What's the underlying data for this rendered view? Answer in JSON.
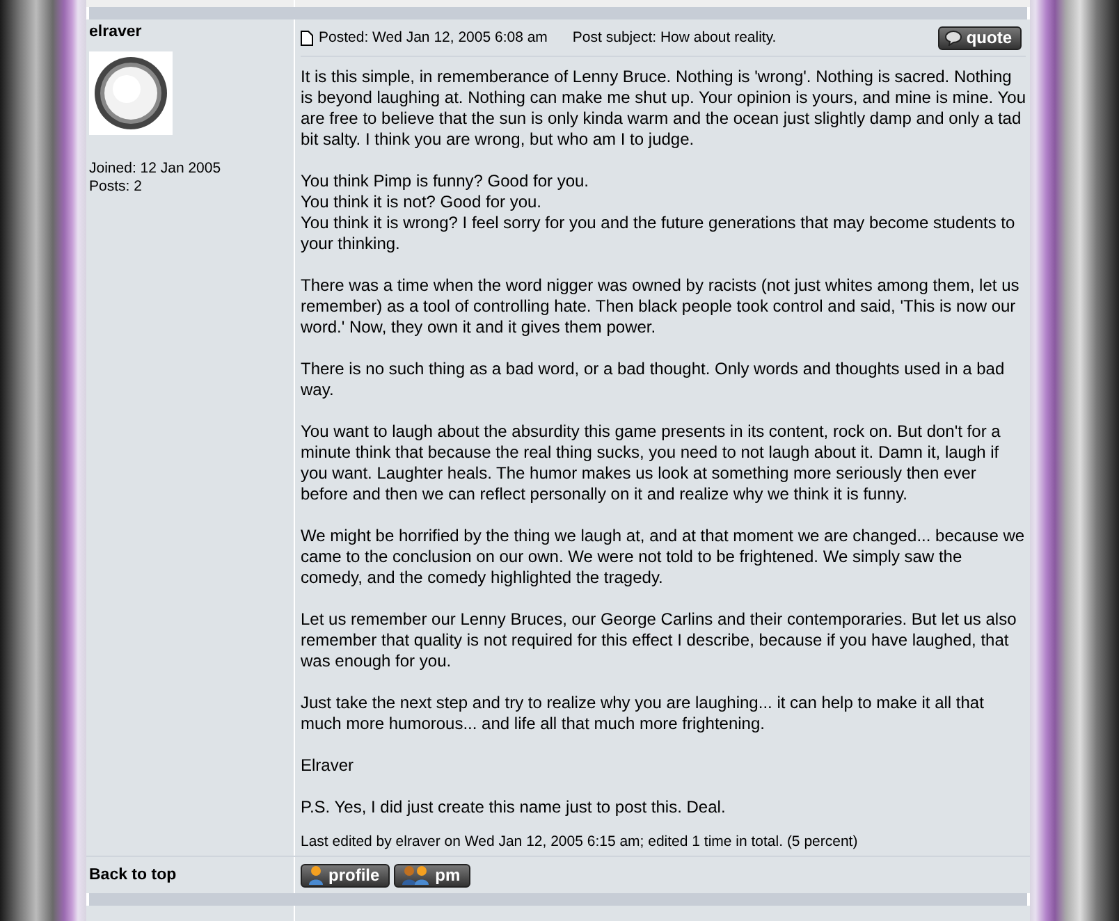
{
  "post": {
    "author": "elraver",
    "joined": "Joined: 12 Jan 2005",
    "posts": "Posts: 2",
    "posted": "Posted: Wed Jan 12, 2005 6:08 am",
    "subject": "Post subject: How about reality.",
    "quote_button": "quote",
    "paragraphs": [
      "It is this simple, in rememberance of Lenny Bruce. Nothing is 'wrong'. Nothing is sacred. Nothing is beyond laughing at. Nothing can make me shut up. Your opinion is yours, and mine is mine. You are free to believe that the sun is only kinda warm and the ocean just slightly damp and only a tad bit salty. I think you are wrong, but who am I to judge.",
      "You think Pimp is funny? Good for you.\nYou think it is not? Good for you.\nYou think it is wrong? I feel sorry for you and the future generations that may become students to your thinking.",
      "There was a time when the word nigger was owned by racists (not just whites among them, let us remember) as a tool of controlling hate. Then black people took control and said, 'This is now our word.' Now, they own it and it gives them power.",
      "There is no such thing as a bad word, or a bad thought. Only words and thoughts used in a bad way.",
      "You want to laugh about the absurdity this game presents in its content, rock on. But don't for a minute think that because the real thing sucks, you need to not laugh about it. Damn it, laugh if you want. Laughter heals. The humor makes us look at something more seriously then ever before and then we can reflect personally on it and realize why we think it is funny.",
      "We might be horrified by the thing we laugh at, and at that moment we are changed... because we came to the conclusion on our own. We were not told to be frightened. We simply saw the comedy, and the comedy highlighted the tragedy.",
      "Let us remember our Lenny Bruces, our George Carlins and their contemporaries. But let us also remember that quality is not required for this effect I describe, because if you have laughed, that was enough for you.",
      "Just take the next step and try to realize why you are laughing... it can help to make it all that much more humorous... and life all that much more frightening.",
      "Elraver",
      "P.S. Yes, I did just create this name just to post this. Deal."
    ],
    "edit_note": "Last edited by elraver on Wed Jan 12, 2005 6:15 am; edited 1 time in total. (5 percent)",
    "back_to_top": "Back to top",
    "buttons": [
      {
        "label": "profile",
        "kind": "profile"
      },
      {
        "label": "pm",
        "kind": "pm"
      }
    ]
  }
}
